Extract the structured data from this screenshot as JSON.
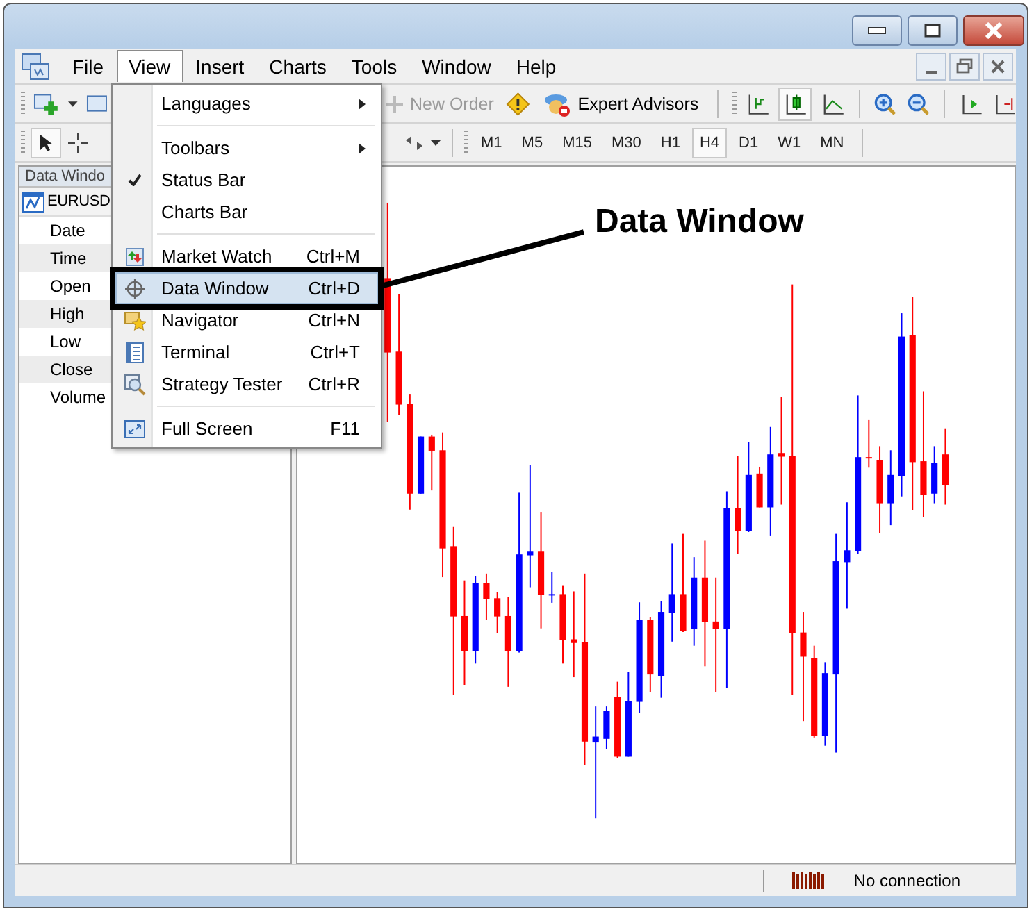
{
  "menu_bar": [
    {
      "label": "File",
      "selected": false
    },
    {
      "label": "View",
      "selected": true
    },
    {
      "label": "Insert",
      "selected": false
    },
    {
      "label": "Charts",
      "selected": false
    },
    {
      "label": "Tools",
      "selected": false
    },
    {
      "label": "Window",
      "selected": false
    },
    {
      "label": "Help",
      "selected": false
    }
  ],
  "toolbar": [
    {
      "label": "New Order",
      "disabled": true
    },
    {
      "label": "Expert Advisors",
      "disabled": false
    }
  ],
  "timeframes": [
    {
      "label": "M1",
      "selected": false
    },
    {
      "label": "M5",
      "selected": false
    },
    {
      "label": "M15",
      "selected": false
    },
    {
      "label": "M30",
      "selected": false
    },
    {
      "label": "H1",
      "selected": false
    },
    {
      "label": "H4",
      "selected": true
    },
    {
      "label": "D1",
      "selected": false
    },
    {
      "label": "W1",
      "selected": false
    },
    {
      "label": "MN",
      "selected": false
    }
  ],
  "data_window": {
    "title": "Data Windo",
    "symbol": "EURUSD",
    "rows": [
      "Date",
      "Time",
      "Open",
      "High",
      "Low",
      "Close",
      "Volume"
    ]
  },
  "view_menu": [
    {
      "kind": "submenu",
      "label": "Languages",
      "checked": false,
      "selected": false
    },
    {
      "kind": "separator"
    },
    {
      "kind": "submenu",
      "label": "Toolbars",
      "checked": false,
      "selected": false
    },
    {
      "kind": "item",
      "label": "Status Bar",
      "checked": true,
      "selected": false
    },
    {
      "kind": "item",
      "label": "Charts Bar",
      "checked": false,
      "selected": false
    },
    {
      "kind": "separator"
    },
    {
      "kind": "item",
      "label": "Market Watch",
      "shortcut": "Ctrl+M",
      "checked": false,
      "selected": false
    },
    {
      "kind": "item",
      "label": "Data Window",
      "shortcut": "Ctrl+D",
      "checked": false,
      "selected": true
    },
    {
      "kind": "item",
      "label": "Navigator",
      "shortcut": "Ctrl+N",
      "checked": false,
      "selected": false
    },
    {
      "kind": "item",
      "label": "Terminal",
      "shortcut": "Ctrl+T",
      "checked": false,
      "selected": false
    },
    {
      "kind": "item",
      "label": "Strategy Tester",
      "shortcut": "Ctrl+R",
      "checked": false,
      "selected": false
    },
    {
      "kind": "separator"
    },
    {
      "kind": "item",
      "label": "Full Screen",
      "shortcut": "F11",
      "checked": false,
      "selected": false
    }
  ],
  "callout": {
    "label": "Data Window"
  },
  "status_bar": {
    "text": "No connection"
  }
}
